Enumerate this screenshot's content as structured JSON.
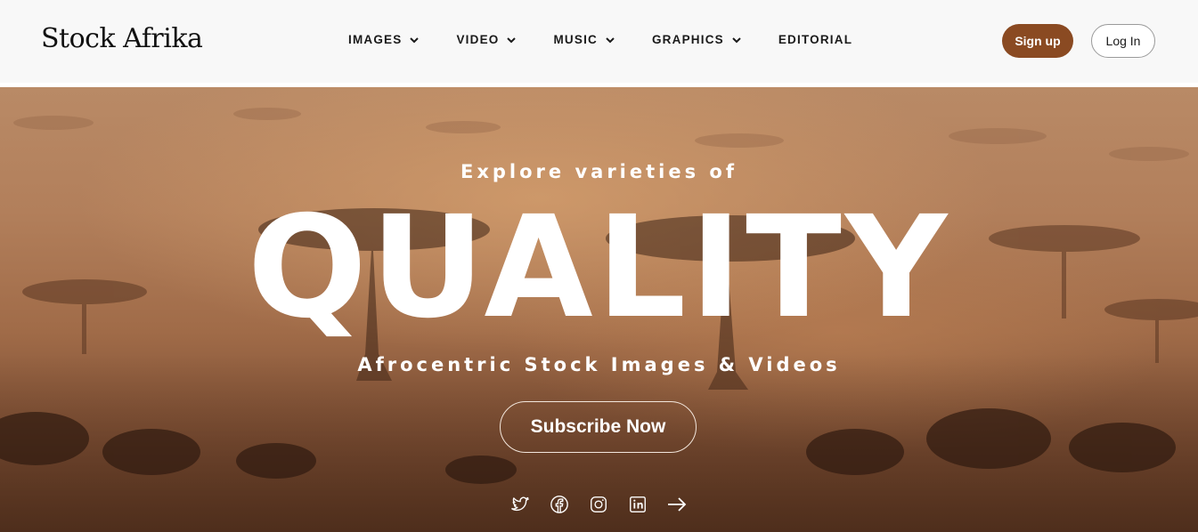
{
  "header": {
    "logo": "Stock Afrika",
    "nav": [
      {
        "label": "IMAGES",
        "has_dropdown": true
      },
      {
        "label": "VIDEO",
        "has_dropdown": true
      },
      {
        "label": "MUSIC",
        "has_dropdown": true
      },
      {
        "label": "GRAPHICS",
        "has_dropdown": true
      },
      {
        "label": "EDITORIAL",
        "has_dropdown": false
      }
    ],
    "signup_label": "Sign up",
    "login_label": "Log In"
  },
  "hero": {
    "subtitle": "Explore varieties of",
    "title": "QUALITY",
    "tagline": "Afrocentric Stock Images & Videos",
    "cta_label": "Subscribe Now",
    "socials": [
      "twitter-icon",
      "facebook-icon",
      "instagram-icon",
      "linkedin-icon",
      "arrow-right-icon"
    ]
  },
  "colors": {
    "brand": "#8a4a22",
    "header_bg": "#f8f8f8",
    "hero_text": "#ffffff"
  }
}
